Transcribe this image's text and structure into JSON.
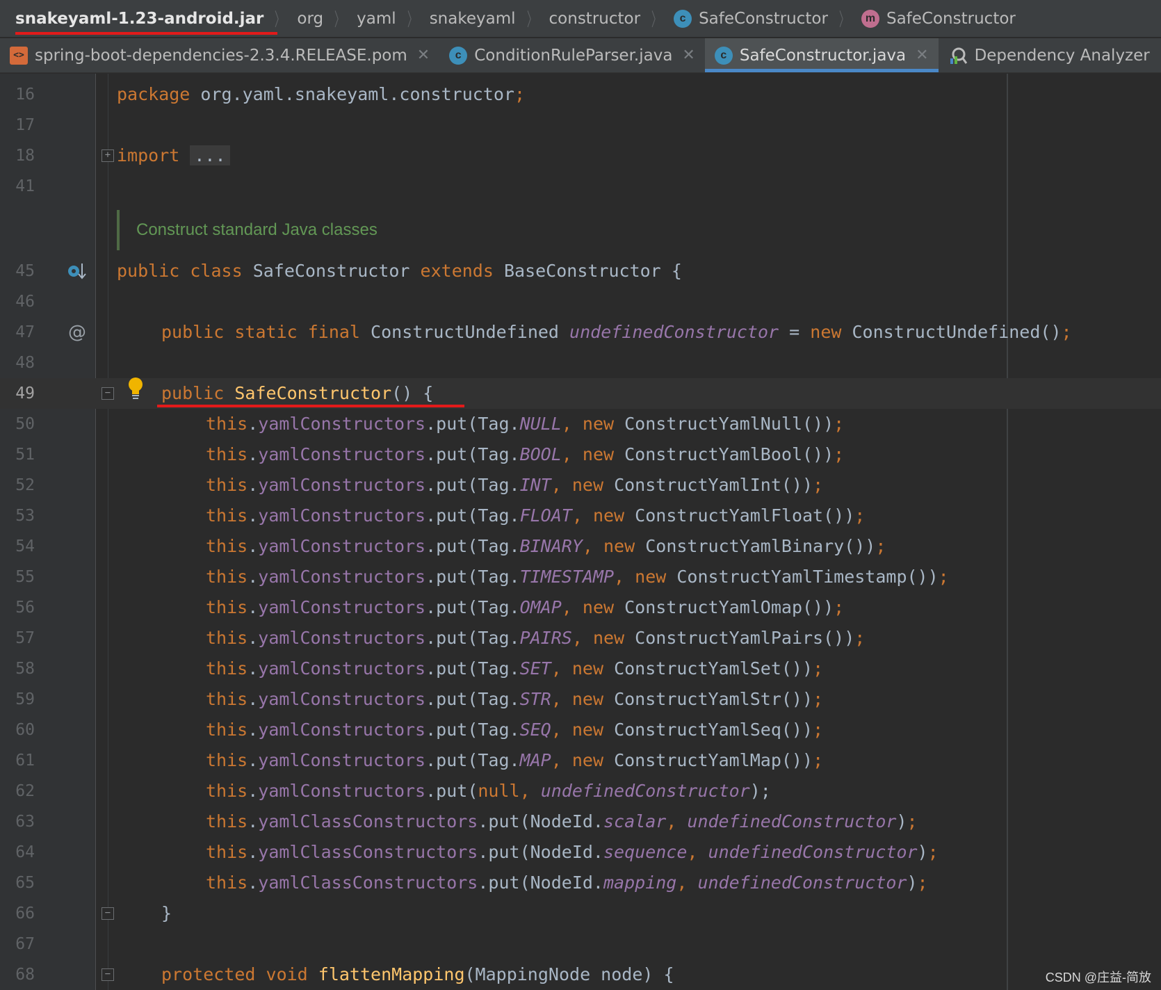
{
  "breadcrumb": {
    "items": [
      {
        "label": "snakeyaml-1.23-android.jar"
      },
      {
        "label": "org"
      },
      {
        "label": "yaml"
      },
      {
        "label": "snakeyaml"
      },
      {
        "label": "constructor"
      },
      {
        "label": "SafeConstructor",
        "badge": "c"
      },
      {
        "label": "SafeConstructor",
        "badge": "m"
      }
    ]
  },
  "tabs": [
    {
      "label": "spring-boot-dependencies-2.3.4.RELEASE.pom",
      "icon": "maven-pom-icon",
      "active": false
    },
    {
      "label": "ConditionRuleParser.java",
      "icon": "java-class-icon",
      "active": false
    },
    {
      "label": "SafeConstructor.java",
      "icon": "java-class-icon",
      "active": true
    },
    {
      "label": "Dependency Analyzer",
      "icon": "dependency-analyzer-icon",
      "active": false
    }
  ],
  "editor": {
    "current_line": "49",
    "doc_comment": "Construct standard Java classes",
    "line_numbers": [
      "16",
      "17",
      "18",
      "41",
      "45",
      "46",
      "47",
      "48",
      "49",
      "50",
      "51",
      "52",
      "53",
      "54",
      "55",
      "56",
      "57",
      "58",
      "59",
      "60",
      "61",
      "62",
      "63",
      "64",
      "65",
      "66",
      "67",
      "68"
    ],
    "code": {
      "package_kw": "package",
      "package_name": "org.yaml.snakeyaml.constructor",
      "import_kw": "import",
      "import_fold": "...",
      "class_decl": {
        "public": "public",
        "class": "class",
        "name": "SafeConstructor",
        "extends": "extends",
        "base": "BaseConstructor",
        "brace": "{"
      },
      "field_decl": {
        "mods": "public static final",
        "type": "ConstructUndefined",
        "name": "undefinedConstructor",
        "eq": "=",
        "new": "new",
        "init": "ConstructUndefined()"
      },
      "ctor_decl": {
        "public": "public",
        "name": "SafeConstructor",
        "rest": "() {"
      },
      "put_lines": [
        {
          "tag": "NULL",
          "ctor": "ConstructYamlNull()"
        },
        {
          "tag": "BOOL",
          "ctor": "ConstructYamlBool()"
        },
        {
          "tag": "INT",
          "ctor": "ConstructYamlInt()"
        },
        {
          "tag": "FLOAT",
          "ctor": "ConstructYamlFloat()"
        },
        {
          "tag": "BINARY",
          "ctor": "ConstructYamlBinary()"
        },
        {
          "tag": "TIMESTAMP",
          "ctor": "ConstructYamlTimestamp()"
        },
        {
          "tag": "OMAP",
          "ctor": "ConstructYamlOmap()"
        },
        {
          "tag": "PAIRS",
          "ctor": "ConstructYamlPairs()"
        },
        {
          "tag": "SET",
          "ctor": "ConstructYamlSet()"
        },
        {
          "tag": "STR",
          "ctor": "ConstructYamlStr()"
        },
        {
          "tag": "SEQ",
          "ctor": "ConstructYamlSeq()"
        },
        {
          "tag": "MAP",
          "ctor": "ConstructYamlMap()"
        }
      ],
      "null_line": {
        "this": "this",
        "field": "yamlConstructors",
        "call": ".put(",
        "arg1": "null",
        "arg2": "undefinedConstructor",
        "end": ");"
      },
      "class_put_lines": [
        {
          "node": "scalar"
        },
        {
          "node": "sequence"
        },
        {
          "node": "mapping"
        }
      ],
      "close_brace": "}",
      "method_decl": {
        "mods": "protected void",
        "name": "flattenMapping",
        "params": "(MappingNode node) {"
      }
    }
  },
  "watermark": "CSDN @庄益-简放",
  "colors": {
    "keyword": "#cc7832",
    "field": "#9876aa",
    "method": "#ffc66d",
    "comment": "#629755",
    "highlight": "#e21a1a",
    "tab_active_underline": "#4a88c7"
  }
}
